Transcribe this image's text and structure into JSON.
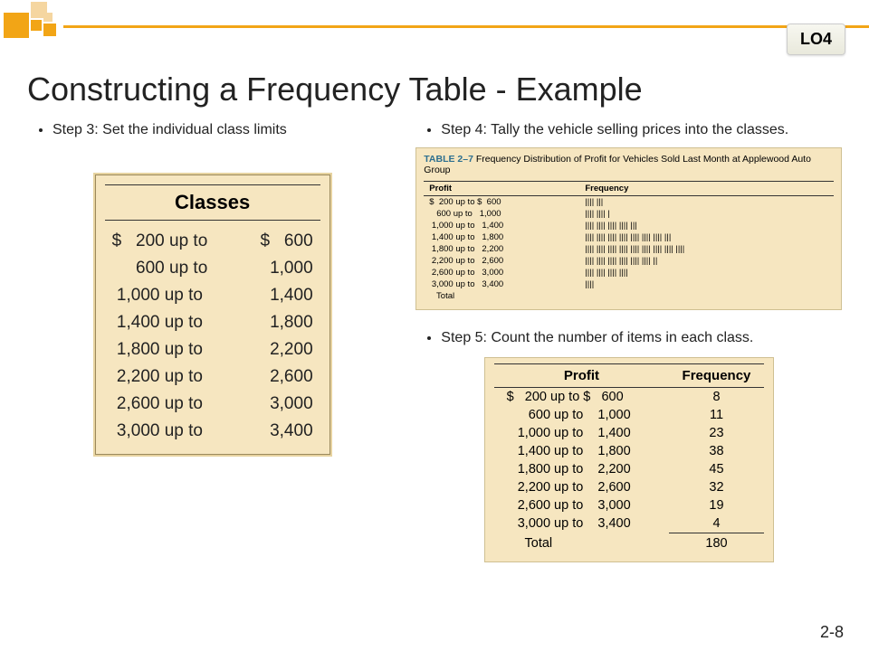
{
  "lo_badge": "LO4",
  "title": "Constructing a Frequency Table - Example",
  "left": {
    "step3": "Step 3: Set the individual class limits",
    "classes_header": "Classes",
    "classes": [
      {
        "a": "$   200",
        "mid": "up to",
        "b": "$   600"
      },
      {
        "a": "     600",
        "mid": "up to",
        "b": " 1,000"
      },
      {
        "a": " 1,000",
        "mid": "up to",
        "b": " 1,400"
      },
      {
        "a": " 1,400",
        "mid": "up to",
        "b": " 1,800"
      },
      {
        "a": " 1,800",
        "mid": "up to",
        "b": " 2,200"
      },
      {
        "a": " 2,200",
        "mid": "up to",
        "b": " 2,600"
      },
      {
        "a": " 2,600",
        "mid": "up to",
        "b": " 3,000"
      },
      {
        "a": " 3,000",
        "mid": "up to",
        "b": " 3,400"
      }
    ]
  },
  "right": {
    "step4": "Step 4: Tally the vehicle selling prices into the classes.",
    "table27": {
      "label": "TABLE 2–7",
      "caption": "Frequency Distribution of Profit for Vehicles Sold Last Month at Applewood Auto Group",
      "col_profit": "Profit",
      "col_freq": "Frequency",
      "rows": [
        {
          "range": "$  200 up to $  600",
          "tally": "|||| |||"
        },
        {
          "range": "   600 up to   1,000",
          "tally": "|||| |||| |"
        },
        {
          "range": " 1,000 up to   1,400",
          "tally": "|||| |||| |||| |||| |||"
        },
        {
          "range": " 1,400 up to   1,800",
          "tally": "|||| |||| |||| |||| |||| |||| |||| |||"
        },
        {
          "range": " 1,800 up to   2,200",
          "tally": "|||| |||| |||| |||| |||| |||| |||| |||| ||||"
        },
        {
          "range": " 2,200 up to   2,600",
          "tally": "|||| |||| |||| |||| |||| |||| ||"
        },
        {
          "range": " 2,600 up to   3,000",
          "tally": "|||| |||| |||| ||||"
        },
        {
          "range": " 3,000 up to   3,400",
          "tally": "||||"
        },
        {
          "range": "   Total",
          "tally": ""
        }
      ]
    },
    "step5": "Step 5: Count the number of items in each class.",
    "freq_table": {
      "col_profit": "Profit",
      "col_freq": "Frequency",
      "rows": [
        {
          "range": "$   200 up to $   600",
          "val": "8"
        },
        {
          "range": "      600 up to    1,000",
          "val": "11"
        },
        {
          "range": "   1,000 up to    1,400",
          "val": "23"
        },
        {
          "range": "   1,400 up to    1,800",
          "val": "38"
        },
        {
          "range": "   1,800 up to    2,200",
          "val": "45"
        },
        {
          "range": "   2,200 up to    2,600",
          "val": "32"
        },
        {
          "range": "   2,600 up to    3,000",
          "val": "19"
        },
        {
          "range": "   3,000 up to    3,400",
          "val": "4"
        }
      ],
      "total_label": "     Total",
      "total_val": "180"
    }
  },
  "page_num": "2-8",
  "chart_data": {
    "type": "table",
    "title": "Frequency Distribution of Profit for Vehicles Sold Last Month at Applewood Auto Group",
    "categories": [
      "$200–600",
      "$600–1,000",
      "$1,000–1,400",
      "$1,400–1,800",
      "$1,800–2,200",
      "$2,200–2,600",
      "$2,600–3,000",
      "$3,000–3,400"
    ],
    "values": [
      8,
      11,
      23,
      38,
      45,
      32,
      19,
      4
    ],
    "total": 180,
    "xlabel": "Profit",
    "ylabel": "Frequency"
  }
}
